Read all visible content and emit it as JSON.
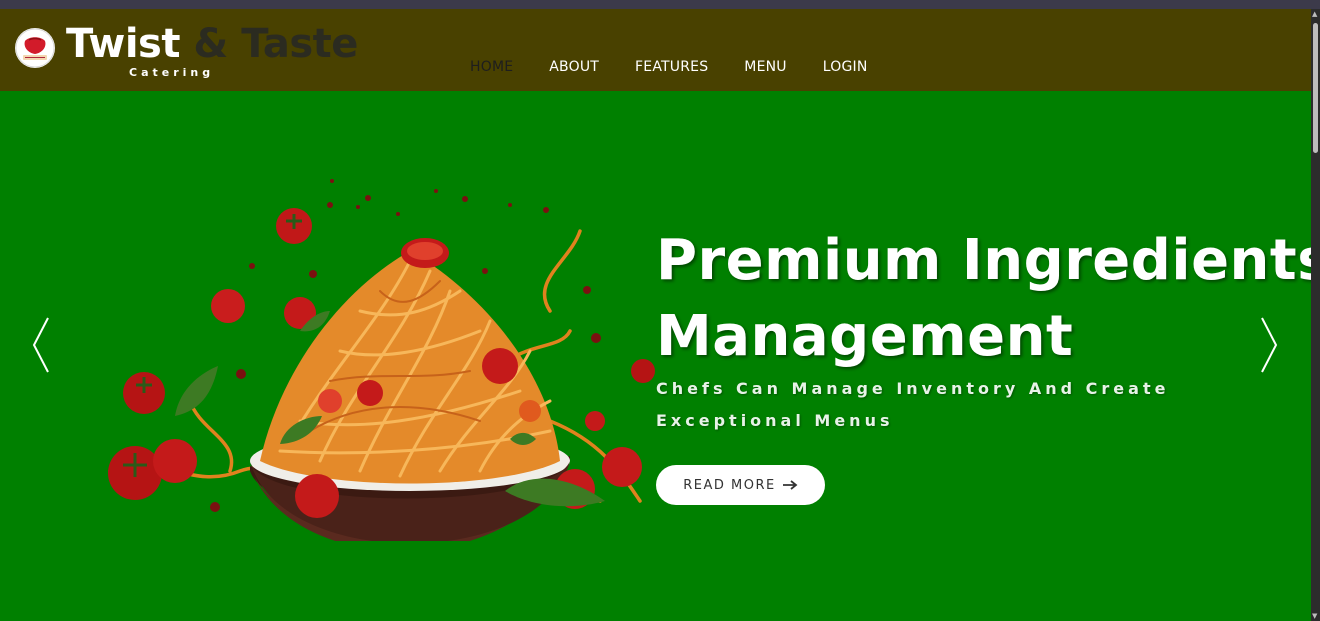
{
  "brand": {
    "name_part1": "Twist",
    "name_part2": "& Taste",
    "tagline": "Catering",
    "logo_icon": "twist-and-taste-logo"
  },
  "nav": {
    "items": [
      {
        "label": "HOME",
        "active": true
      },
      {
        "label": "ABOUT",
        "active": false
      },
      {
        "label": "FEATURES",
        "active": false
      },
      {
        "label": "MENU",
        "active": false
      },
      {
        "label": "LOGIN",
        "active": false
      }
    ]
  },
  "hero": {
    "headline_line1": "Premium Ingredients",
    "headline_line2": "Management",
    "subheadline": "Chefs Can Manage Inventory And Create Exceptional Menus",
    "cta_label": "READ MORE",
    "cta_icon": "arrow-right-icon",
    "prev_icon": "chevron-left-icon",
    "next_icon": "chevron-right-icon",
    "image": "spaghetti-bowl-with-tomatoes"
  },
  "colors": {
    "navbar_bg": "#494100",
    "hero_bg": "#008000",
    "accent_white": "#ffffff"
  }
}
